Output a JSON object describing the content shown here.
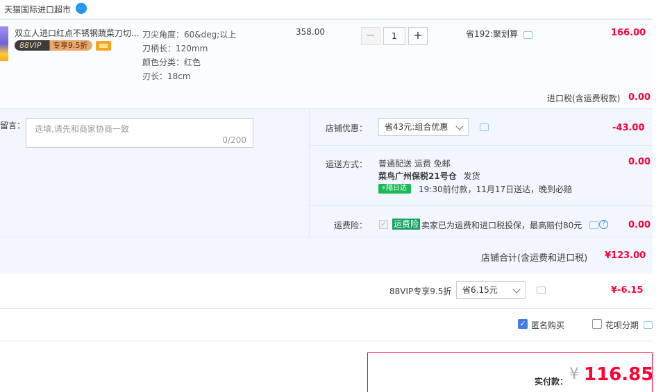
{
  "shop": {
    "name": "天猫国际进口超市"
  },
  "item": {
    "title": "双立人进口红点不锈钢蔬菜刀切...",
    "vip_label": "88VIP",
    "vip_discount": "专享9.5折",
    "props": [
      "刀尖角度：60&deg;以上",
      "刀柄长：120mm",
      "颜色分类：红色",
      "刃长：18cm"
    ],
    "price": "358.00",
    "quantity": "1",
    "minus_label": "−",
    "plus_label": "+",
    "promo": "省192:聚划算",
    "subtotal": "166.00",
    "tax_label": "进口税(含运费税款)",
    "tax_value": "0.00"
  },
  "memo": {
    "label": "留言：",
    "placeholder": "选填,请先和商家协商一致",
    "count": "0/200"
  },
  "shop_discount": {
    "label": "店铺优惠：",
    "selected": "省43元:组合优惠",
    "value": "-43.00"
  },
  "shipping": {
    "label": "运送方式：",
    "method": "普通配送 运费 免邮",
    "warehouse": "菜鸟广州保税21号仓",
    "warehouse_suffix": "发货",
    "badge": "隔日达",
    "delivery_note": "19:30前付款，11月17日送达，晚到必赔",
    "value": "0.00"
  },
  "insurance": {
    "label": "运费险：",
    "tag": "运费险",
    "text": "卖家已为运费和进口税投保，最高赔付80元",
    "value": "0.00"
  },
  "shop_total": {
    "label": "店铺合计(含运费和进口税)",
    "value": "¥123.00"
  },
  "vip": {
    "label": "88VIP专享9.5折",
    "selected": "省6.15元",
    "value": "¥-6.15"
  },
  "options": {
    "anonymous": "匿名购买",
    "anonymous_checked": true,
    "huabei": "花呗分期",
    "huabei_checked": false
  },
  "payment": {
    "label": "实付款：",
    "currency": "¥",
    "amount": "116.85"
  },
  "colors": {
    "accent": "#ff0036",
    "brand_blue": "#3d7de4",
    "green": "#19a15f"
  }
}
